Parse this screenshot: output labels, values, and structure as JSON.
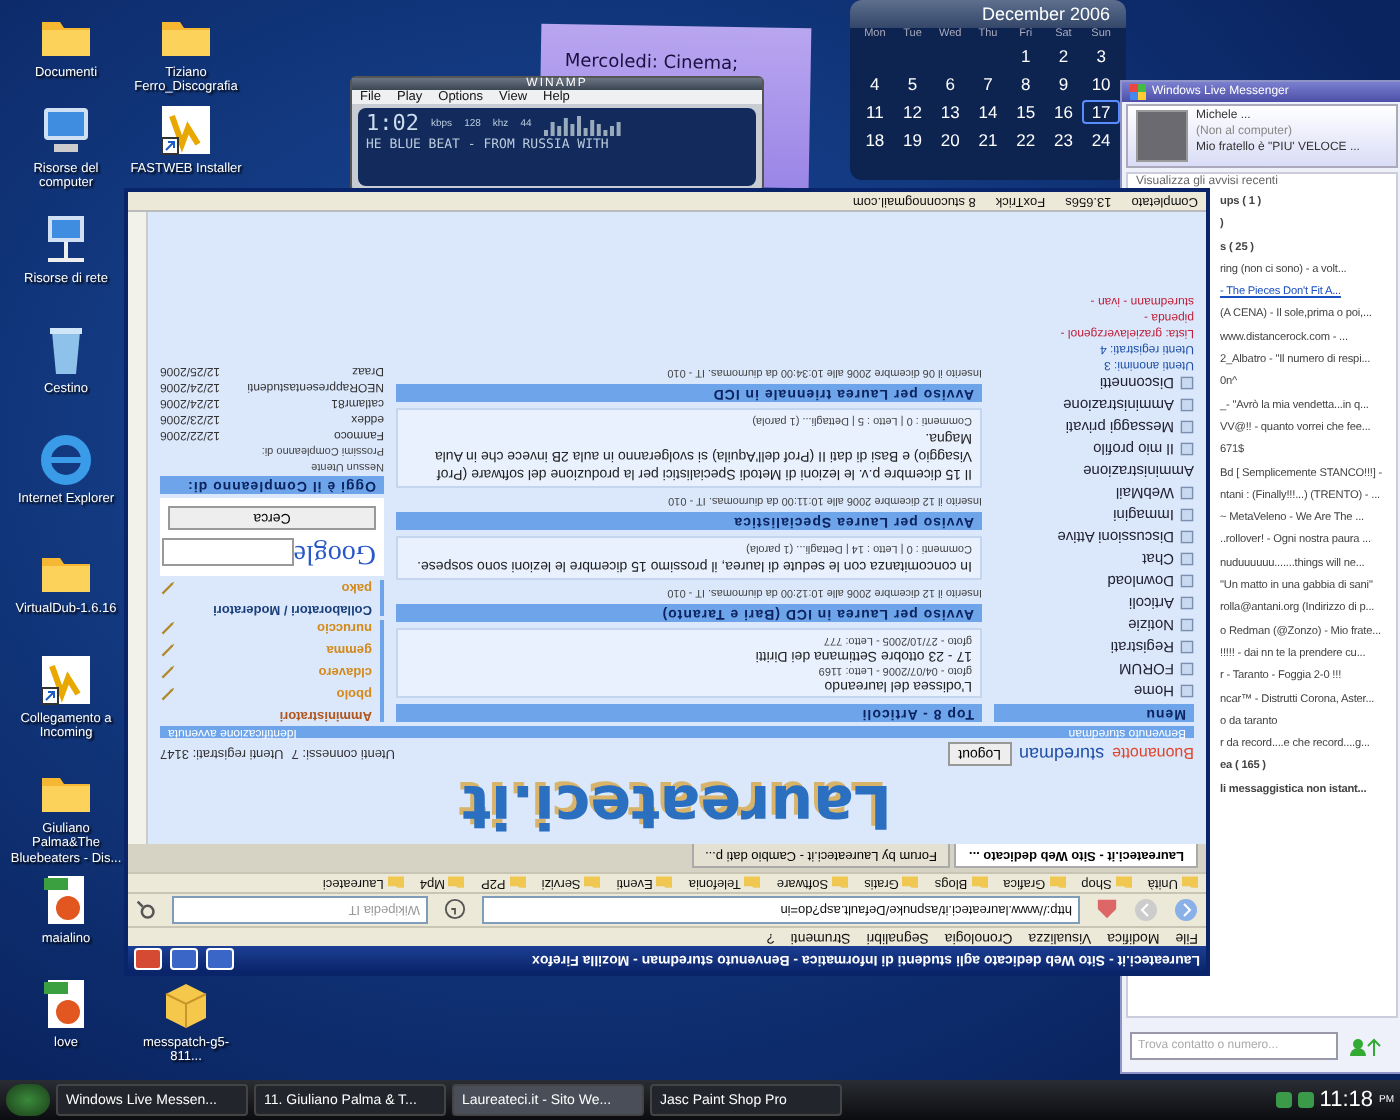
{
  "desktop_icons": [
    {
      "label": "Documenti",
      "kind": "folder"
    },
    {
      "label": "Tiziano Ferro_Discografia",
      "kind": "folder"
    },
    {
      "label": "Risorse del computer",
      "kind": "computer"
    },
    {
      "label": "FASTWEB Installer",
      "kind": "shortcut"
    },
    {
      "label": "Risorse di rete",
      "kind": "network"
    },
    {
      "label": "Cestino",
      "kind": "bin"
    },
    {
      "label": "Internet Explorer",
      "kind": "browser"
    },
    {
      "label": "VirtualDub-1.6.16",
      "kind": "folder"
    },
    {
      "label": "Collegamento a Incoming",
      "kind": "shortcut"
    },
    {
      "label": "Giuliano Palma&The Bluebeaters - Dis...",
      "kind": "folder"
    },
    {
      "label": "maialino",
      "kind": "image"
    },
    {
      "label": "love",
      "kind": "image"
    },
    {
      "label": "messpatch-g5-811...",
      "kind": "package"
    }
  ],
  "sticky_note": {
    "text": "Mercoledi: Cinema;"
  },
  "winamp": {
    "title": "WINAMP",
    "menu": [
      "File",
      "Play",
      "Options",
      "View",
      "Help"
    ],
    "time": "1:02",
    "kbps": "kbps",
    "bitrate": "128",
    "khz": "khz",
    "rate": "44",
    "ticker": "HE BLUE BEAT - FROM RUSSIA WITH"
  },
  "calendar": {
    "title": "December 2006",
    "weekdays": [
      "Mon",
      "Tue",
      "Wed",
      "Thu",
      "Fri",
      "Sat",
      "Sun"
    ],
    "weeks": [
      [
        {
          "day": "1",
          "selected": false
        },
        {
          "day": "2",
          "selected": false
        },
        {
          "day": "3",
          "selected": false
        }
      ],
      [
        {
          "day": "4",
          "selected": false
        },
        {
          "day": "5",
          "selected": false
        },
        {
          "day": "6",
          "selected": false
        },
        {
          "day": "7",
          "selected": false
        },
        {
          "day": "8",
          "selected": false
        },
        {
          "day": "9",
          "selected": false
        },
        {
          "day": "10",
          "selected": false
        }
      ],
      [
        {
          "day": "11",
          "selected": false
        },
        {
          "day": "12",
          "selected": false
        },
        {
          "day": "13",
          "selected": false
        },
        {
          "day": "14",
          "selected": false
        },
        {
          "day": "15",
          "selected": false
        },
        {
          "day": "16",
          "selected": false
        },
        {
          "day": "17",
          "selected": true
        }
      ],
      [
        {
          "day": "18",
          "selected": false
        },
        {
          "day": "19",
          "selected": false
        },
        {
          "day": "20",
          "selected": false
        },
        {
          "day": "21",
          "selected": false
        },
        {
          "day": "22",
          "selected": false
        },
        {
          "day": "23",
          "selected": false
        },
        {
          "day": "24",
          "selected": false
        }
      ]
    ]
  },
  "messenger": {
    "title": "Windows Live Messenger",
    "name": "Michele ...",
    "status": "(Non al computer)",
    "message": "Mio fratello è \"PIU' VELOCE ...",
    "alerts": "Visualizza gli avvisi recenti",
    "search": {
      "placeholder": "Trova contatto o numero..."
    },
    "contacts": [
      {
        "text": "ups ( 1 )",
        "kind": "group"
      },
      {
        "text": ")",
        "kind": "group"
      },
      {
        "text": "s ( 25 )",
        "kind": "group"
      },
      {
        "text": "ring (non ci sono) - a volt...",
        "kind": "contact"
      },
      {
        "text": "- The Pieces Don't Fit A...",
        "kind": "link"
      },
      {
        "text": "(A CENA) - Il sole,prima o poi,...",
        "kind": "contact"
      },
      {
        "text": "www.distancerock.com - ...",
        "kind": "contact"
      },
      {
        "text": "2_Albatro - \"Il numero di respi...",
        "kind": "contact"
      },
      {
        "text": "0n^",
        "kind": "contact"
      },
      {
        "text": "_- \"Avrò la mia vendetta...in q...",
        "kind": "contact"
      },
      {
        "text": "VV@!! - quanto vorrei che fee...",
        "kind": "contact"
      },
      {
        "text": "671$",
        "kind": "contact"
      },
      {
        "text": "Bd [ Semplicemente STANCO!!!] -",
        "kind": "contact"
      },
      {
        "text": "ntani : (Finally!!!...) (TRENTO) - ...",
        "kind": "contact"
      },
      {
        "text": "~ MetaVeleno - We Are The ...",
        "kind": "contact"
      },
      {
        "text": "..rollover! - Ogni nostra paura ...",
        "kind": "contact"
      },
      {
        "text": "nuduuuuuu.......things will ne...",
        "kind": "contact"
      },
      {
        "text": "\"Un matto in una gabbia di sani\"",
        "kind": "contact"
      },
      {
        "text": "rolla@antani.org (Indirizzo di p...",
        "kind": "contact"
      },
      {
        "text": "o Redman (@Zonzo) - Mio frate...",
        "kind": "contact"
      },
      {
        "text": "!!!!! - dai nn te la prendere cu...",
        "kind": "contact"
      },
      {
        "text": "r - Taranto - Foggia 2-0 !!!",
        "kind": "contact"
      },
      {
        "text": "ncar™ - Distrutti Corona, Aster...",
        "kind": "contact"
      },
      {
        "text": "o da taranto",
        "kind": "contact"
      },
      {
        "text": "r da record....e che record....g...",
        "kind": "contact"
      },
      {
        "text": "ea ( 165 )",
        "kind": "group"
      },
      {
        "text": "li messaggistica non istant...",
        "kind": "group"
      }
    ]
  },
  "browser": {
    "title": "Laureateci.it - Sito Web dedicato agli studenti di Informatica - Benvenuto sturedman - Mozilla Firefox",
    "menu": [
      "File",
      "Modifica",
      "Visualizza",
      "Cronologia",
      "Segnalibri",
      "Strumenti",
      "?"
    ],
    "url": "http://www.laureateci.it/aspnuke/Default.asp?do=in",
    "search_engine": "Wikipedia IT",
    "bookmarks": [
      "Unità",
      "Shop",
      "Grafica",
      "Blogs",
      "Gratis",
      "Software",
      "Telefonia",
      "Eventi",
      "Servizi",
      "P2P",
      "Mp4",
      "Laureateci"
    ],
    "tabs": [
      {
        "label": "Laureateci.it - Sito Web dedicato ...",
        "selected": true
      },
      {
        "label": "Forum by Laureateci.it - Cambio dati p...",
        "selected": false
      }
    ],
    "logo": "Laureateci.it",
    "greeting": "Buonanotte",
    "user": "sturedman",
    "logout": "Logout",
    "online": "Utenti connessi: 7",
    "registered": "Utenti registrati: 3147",
    "welcome_bar": "Benvenuto sturedman",
    "identified_bar": "Identificazione avvenuta",
    "menu_title": "Menu",
    "menu_items": [
      "Home",
      "FORUM",
      "Registrati",
      "Notizie",
      "Articoli",
      "Download",
      "Chat",
      "Discussioni Attive",
      "Immagini",
      "WebMail"
    ],
    "admin_title": "Amministrazione",
    "admin_items": [
      "Il mio profilo",
      "Messaggi privati",
      "Amministrazione",
      "Disconnetti"
    ],
    "user_stats": [
      "Utenti anonimi: 3",
      "Utenti registrati: 4",
      "Lista: grazielaverzgenol -",
      "pipenda -",
      "sturedmann - ivan -"
    ],
    "top_title": "Top 8 - Articoli",
    "top_articles": [
      {
        "title": "L'odissea del laureando",
        "meta": "gfoto - 04/07/2006 - Letto: 1169"
      },
      {
        "title": "17 - 23 ottobre Settimana dei Diritti",
        "meta": "gfoto - 27/10/2005 - Letto: 777"
      }
    ],
    "news": [
      {
        "title": "Avviso per Laurea in ICD (Bari e Taranto)",
        "posted": "Inserito il 12 dicembre 2006 alle 10:12:00 da diurnomas. IT - 010",
        "body": "In concomitanza con le sedute di laurea, il prossimo 15 dicembre le lezioni sono sospese.",
        "footer": "Commenti : 0 | Letto : 14 | Dettagli... (1 parola)"
      },
      {
        "title": "Avviso per Laurea Specialistica",
        "posted": "Inserito il 12 dicembre 2006 alle 10:11:00 da diurnomas. IT - 010",
        "body": "Il 15 dicembre p.v. le lezioni di Metodi Specialistici per la produzione del software (Prof Visaggio) e Basi di dati II (Prof dell'Aquila) si svolgeranno in aula 2B invece che in Aula Magna.",
        "footer": "Commenti : 0 | Letto : 5 | Dettagli... (1 parola)"
      },
      {
        "title": "Avviso per Laurea triennale in ICD",
        "posted": "Inserito il 06 dicembre 2006 alle 10:34:00 da diurnomas. IT - 010"
      }
    ],
    "staff": [
      {
        "role": "Amministratori",
        "names": [
          "pbolo",
          "cldavero",
          "gemma",
          "nuruccio"
        ]
      },
      {
        "role": "Collaboratori / Moderatori",
        "names": [
          "pako"
        ]
      }
    ],
    "google_button": "Cerca",
    "google_logo": "Google",
    "birthday_title": "Oggi è il Compleanno di:",
    "birthday_none": "Nessun Utente",
    "upcoming_title": "Prossimi Compleanno di:",
    "upcoming": [
      {
        "name": "Fanmoco",
        "date": "12/22/2006"
      },
      {
        "name": "eddex",
        "date": "12/23/2006"
      },
      {
        "name": "catlamr81",
        "date": "12/24/2006"
      },
      {
        "name": "NEORappresentastudenti",
        "date": "12/24/2006"
      },
      {
        "name": "Draaz",
        "date": "12/25/2006"
      }
    ],
    "status": "Completato",
    "status_items": [
      "13.656s",
      "FoxTrick",
      "8 stuconnogmail.com"
    ]
  },
  "taskbar": {
    "items": [
      {
        "label": "Windows Live Messen...",
        "selected": false
      },
      {
        "label": "11. Giuliano Palma & T...",
        "selected": false
      },
      {
        "label": "Laureateci.it - Sito We...",
        "selected": true
      },
      {
        "label": "Jasc Paint Shop Pro",
        "selected": false
      }
    ],
    "clock": "11:18",
    "meridiem": "PM"
  }
}
